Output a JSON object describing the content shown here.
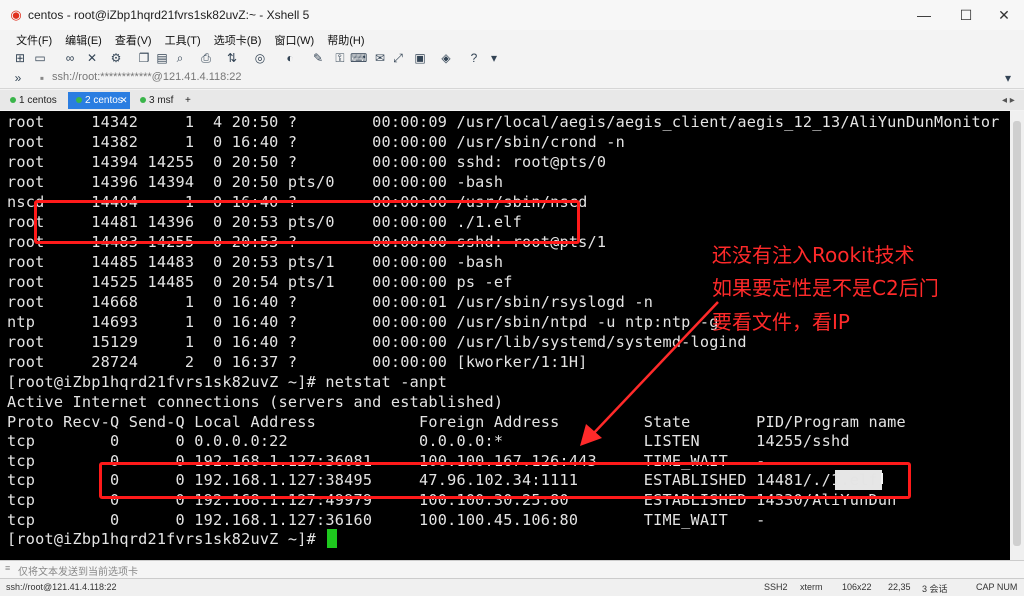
{
  "window": {
    "title": "centos - root@iZbp1hqrd21fvrs1sk82uvZ:~ - Xshell 5",
    "minimize": "—",
    "maximize": "☐",
    "close": "✕"
  },
  "menu": [
    "文件(F)",
    "编辑(E)",
    "查看(V)",
    "工具(T)",
    "选项卡(B)",
    "窗口(W)",
    "帮助(H)"
  ],
  "address": "ssh://root:************@121.41.4.118:22",
  "tabs": [
    {
      "label": "1 centos",
      "active": false
    },
    {
      "label": "2 centos",
      "active": true
    },
    {
      "label": "3 msf",
      "active": false
    }
  ],
  "terminal": {
    "lines": [
      "root     14342     1  4 20:50 ?        00:00:09 /usr/local/aegis/aegis_client/aegis_12_13/AliYunDunMonitor",
      "root     14382     1  0 16:40 ?        00:00:00 /usr/sbin/crond -n",
      "root     14394 14255  0 20:50 ?        00:00:00 sshd: root@pts/0",
      "root     14396 14394  0 20:50 pts/0    00:00:00 -bash",
      "nscd     14404     1  0 16:40 ?        00:00:00 /usr/sbin/nscd",
      "root     14481 14396  0 20:53 pts/0    00:00:00 ./1.elf",
      "root     14483 14255  0 20:53 ?        00:00:00 sshd: root@pts/1",
      "root     14485 14483  0 20:53 pts/1    00:00:00 -bash",
      "root     14525 14485  0 20:54 pts/1    00:00:00 ps -ef",
      "root     14668     1  0 16:40 ?        00:00:01 /usr/sbin/rsyslogd -n",
      "ntp      14693     1  0 16:40 ?        00:00:00 /usr/sbin/ntpd -u ntp:ntp -g",
      "root     15129     1  0 16:40 ?        00:00:00 /usr/lib/systemd/systemd-logind",
      "root     28724     2  0 16:37 ?        00:00:00 [kworker/1:1H]",
      "[root@iZbp1hqrd21fvrs1sk82uvZ ~]# netstat -anpt",
      "Active Internet connections (servers and established)",
      "Proto Recv-Q Send-Q Local Address           Foreign Address         State       PID/Program name",
      "tcp        0      0 0.0.0.0:22              0.0.0.0:*               LISTEN      14255/sshd",
      "tcp        0      0 192.168.1.127:36081     100.100.167.126:443     TIME_WAIT   -",
      "tcp        0      0 192.168.1.127:38495     47.96.102.34:1111       ESTABLISHED 14481/./1.elf",
      "tcp        0      0 192.168.1.127:49979     100.100.30.25:80        ESTABLISHED 14330/AliYunDun",
      "tcp        0      0 192.168.1.127:36160     100.100.45.106:80       TIME_WAIT   -",
      "[root@iZbp1hqrd21fvrs1sk82uvZ ~]# "
    ]
  },
  "annotation": {
    "lines": [
      "还没有注入Rookit技术",
      "如果要定性是不是C2后门",
      "要看文件，看IP"
    ],
    "color": "#ff2a2a"
  },
  "sendbar": {
    "text": "仅将文本发送到当前选项卡"
  },
  "status": {
    "address": "ssh://root@121.41.4.118:22",
    "protocol": "SSH2",
    "term": "xterm",
    "size": "106x22",
    "pos": "22,35",
    "sessions": "3 会话",
    "caps": "CAP NUM"
  }
}
